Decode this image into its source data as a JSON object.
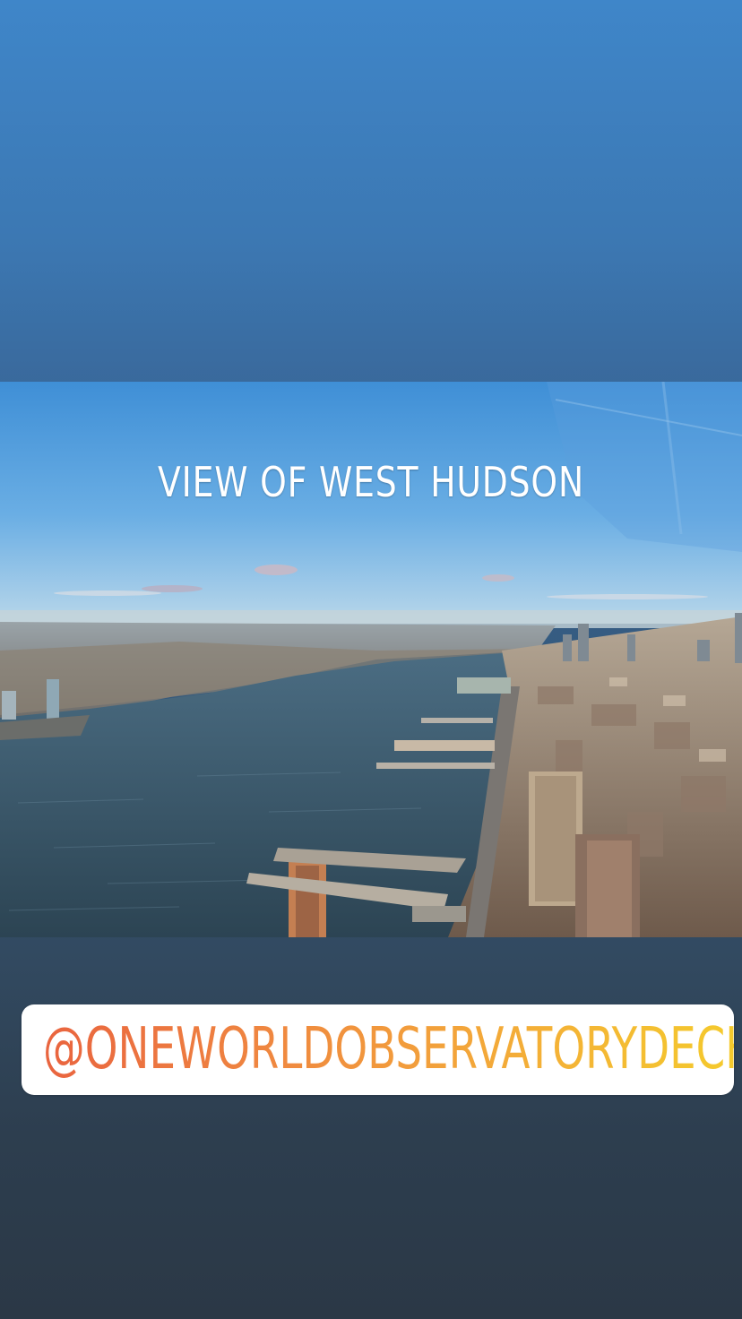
{
  "story": {
    "caption": "VIEW OF WEST HUDSON",
    "mention": "@ONEWORLDOBSERVATORYDECK",
    "photo_subject": "aerial-city-river-photo"
  },
  "colors": {
    "background_top": "#3f86c9",
    "background_bottom": "#2b3846",
    "sticker_background": "#ffffff",
    "mention_gradient_start": "#e9643f",
    "mention_gradient_end": "#f5cd2c",
    "caption_color": "#ffffff"
  }
}
